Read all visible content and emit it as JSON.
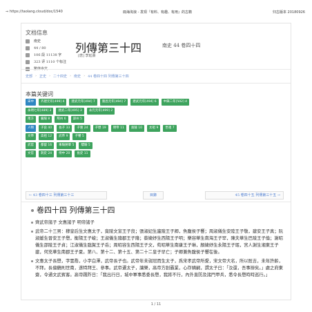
{
  "topbar": {
    "url": "⇒ https://taolang.cloud/doc/1540",
    "title": "冊海淘浪 - 发现『有料、有趣、有用』的古籍",
    "version": "归古版本 20180926"
  },
  "info": {
    "heading": "文档信息",
    "items": [
      {
        "icon": "book-icon",
        "text": "南史"
      },
      {
        "icon": "list-icon",
        "text": "44 / 80"
      },
      {
        "icon": "text-icon",
        "text": "106 段 11138 字"
      },
      {
        "icon": "view-icon",
        "text": "323 评 1110 个标注"
      },
      {
        "icon": "lang-icon",
        "text": "繁体中文"
      }
    ]
  },
  "book": {
    "title": "列傳第三十四",
    "meta": "南史 44 卷四十四",
    "author": "[唐] 李延壽"
  },
  "breadcrumb": [
    "史部",
    "正史",
    "二十四史",
    "南史",
    "44 卷四十四 列傳第三十四"
  ],
  "keywords": {
    "heading": "本篇关键词",
    "rows": [
      [
        {
          "t": "宋中",
          "c": "blue"
        },
        {
          "t": "齐建元年[499] 4",
          "c": "green"
        },
        {
          "t": "建武元年[494] 7",
          "c": "green"
        },
        {
          "t": "隆昌元年[494] 7",
          "c": "green"
        },
        {
          "t": "建武元年[494] 6",
          "c": "green"
        },
        {
          "t": "中興二年[502] 4",
          "c": "green"
        }
      ],
      [
        {
          "t": "永明七年[489] 3",
          "c": "green"
        },
        {
          "t": "建武二年[495] 3",
          "c": "green"
        },
        {
          "t": "永元元年[499] 2",
          "c": "green"
        }
      ],
      [
        {
          "t": "南方",
          "c": "green"
        },
        {
          "t": "襄陽 8",
          "c": "green"
        },
        {
          "t": "荊州 6",
          "c": "green"
        },
        {
          "t": "郢州 5",
          "c": "green"
        }
      ],
      [
        {
          "t": "人物",
          "c": "blue"
        },
        {
          "t": "子良 40",
          "c": "green"
        },
        {
          "t": "長子 33",
          "c": "green"
        },
        {
          "t": "子隆 24",
          "c": "green"
        },
        {
          "t": "子懋 19",
          "c": "green"
        },
        {
          "t": "明帝 11",
          "c": "green"
        },
        {
          "t": "竟陵 10",
          "c": "green"
        },
        {
          "t": "太祖 9",
          "c": "green"
        },
        {
          "t": "世祖 7",
          "c": "green"
        }
      ],
      [
        {
          "t": "文帝",
          "c": "green"
        },
        {
          "t": "高祖 12",
          "c": "green"
        },
        {
          "t": "武帝 9",
          "c": "green"
        },
        {
          "t": "子響 5",
          "c": "green"
        }
      ],
      [
        {
          "t": "武官",
          "c": "green"
        },
        {
          "t": "都督 16",
          "c": "green"
        },
        {
          "t": "車騎將軍 5",
          "c": "green"
        },
        {
          "t": "驃騎 5",
          "c": "green"
        }
      ],
      [
        {
          "t": "文官",
          "c": "green"
        },
        {
          "t": "刺史 24",
          "c": "green"
        },
        {
          "t": "侍中 20",
          "c": "green"
        },
        {
          "t": "長史 11",
          "c": "green"
        }
      ]
    ]
  },
  "pager": {
    "prev": "← 43 卷四十三 列傳第三十三",
    "mid": "目錄",
    "next": "45 卷四十五 列傳第三十五 →"
  },
  "content": {
    "chapter": "卷四十四 列傳第三十四",
    "paragraphs": [
      "齊武帝諸子 文惠諸子 明帝諸子",
      "武帝二十三男：穆皇后生文惠太子，竟陵文宣王子良；張淑妃生廬陵王子卿，魚腹侯子響；周淑儀生安陸王子敬，建安王子真；阮淑媛生晉安王子懋，衡陽王子峻；王淑儀生隨郡王子隆；蔡婕妤生西陽王子明；樂容華生南海王子罕，陳夫華生巴陵王子倫；謝昭儀生邵陵王子貞；江淑儀生臨賀王子岳；周昭容生西陽王子文，荀昭華生南康王子琳，顏婕妤生永陽王子珉，宮人謝生湘東王子建，何充華生南郡王子夏。第八、第十二、第十五、第二十二皇子早亡；子卿兼魚腹侯子響在後。",
      "文惠太子長懋，字雲喬，小字白澤，武帝長子也。武帝年未弱冠而生太子，爲宋孝武帝所愛，宋文帝大名，所以既吉，未年許齡，不拜。長偏鶴則世南，遂特拜王、參事。武帝遷太子，讓樂，高帝方創霸業，心存嫡嗣，謂太子曰：「汝還，吾事辦矣。」處之府東齋，令通文武賓客。高帝踐阼日：「我出行日，城中軍事悉委長懋，我將不行，內外直防及諸門甲兵，悉令長懋時時巡行。」"
    ]
  },
  "footer": {
    "page": "1 / 11"
  }
}
